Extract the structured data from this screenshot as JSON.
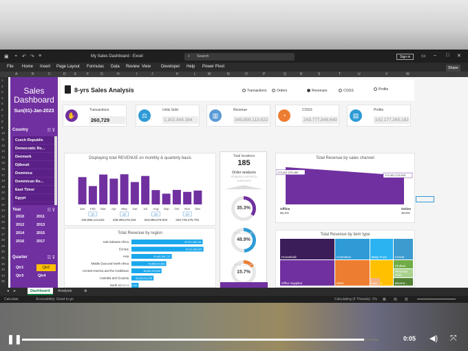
{
  "window": {
    "title": "My Sales Dashboard - Excel",
    "search_placeholder": "Search",
    "signin": "Sign in"
  },
  "menu": [
    "File",
    "Home",
    "Insert",
    "Page Layout",
    "Formulas",
    "Data",
    "Review",
    "View",
    "Developer",
    "Help",
    "Power Pivot"
  ],
  "share_label": "Share",
  "columns": [
    "A",
    "B",
    "C",
    "D",
    "E",
    "F",
    "G",
    "H",
    "I",
    "J",
    "K",
    "L",
    "M",
    "N",
    "O",
    "P",
    "Q",
    "R",
    "S",
    "T",
    "U",
    "V",
    "W"
  ],
  "rows": [
    "1",
    "2",
    "3",
    "4",
    "5",
    "6",
    "7",
    "8",
    "9",
    "10",
    "11",
    "12",
    "13",
    "14",
    "15",
    "16",
    "17",
    "18",
    "19",
    "20",
    "21",
    "22",
    "23",
    "24",
    "25",
    "26",
    "27",
    "28",
    "29",
    "30",
    "31",
    "32",
    "33",
    "34",
    "35"
  ],
  "sidebar": {
    "title": "Sales Dashboard",
    "date": "Sun(01)-Jan-2023",
    "country_label": "Country",
    "countries": [
      "Czech Republic",
      "Democratic Re...",
      "Denmark",
      "Djibouti",
      "Dominica",
      "Dominican Re...",
      "East Timor",
      "Egypt"
    ],
    "year_label": "Year",
    "years": [
      "2010",
      "2011",
      "2012",
      "2013",
      "2014",
      "2015",
      "2016",
      "2017"
    ],
    "quarter_label": "Quarter",
    "quarters": [
      "Qtr1",
      "Qtr2",
      "Qtr3",
      "Qtr4"
    ]
  },
  "header": {
    "title": "8-yrs Sales Analysis",
    "options": [
      "Transactions",
      "Orders",
      "Revenues",
      "COGS",
      "Profits"
    ],
    "selected": "Revenues"
  },
  "kpis": [
    {
      "label": "Transactions",
      "value": "260,729",
      "color": "#7030a0",
      "muted": false
    },
    {
      "label": "Units Sold",
      "value": "1,302,944,384",
      "color": "#2e9bd6",
      "muted": true
    },
    {
      "label": "Revenue",
      "value": "349,899,113,622",
      "color": "#5b9bd5",
      "muted": true
    },
    {
      "label": "COGS",
      "value": "243,777,848,640",
      "color": "#ed7d31",
      "muted": true
    },
    {
      "label": "Profits",
      "value": "102,177,265,182",
      "color": "#2e9bd6",
      "muted": true
    }
  ],
  "center": {
    "total_locations_label": "Total locations",
    "total_locations": "185",
    "order_analysis": "Order analysis",
    "shipping_label": "Shipping interval to customers",
    "donuts": [
      {
        "value": "35.3%",
        "fraction": 0.353,
        "color": "#7030a0"
      },
      {
        "value": "48.9%",
        "fraction": 0.489,
        "color": "#2e9bd6"
      },
      {
        "value": "15.7%",
        "fraction": 0.157,
        "color": "#ed7d31"
      }
    ],
    "within_labels": [
      "within 2 months",
      "within 1 month",
      "within a week"
    ]
  },
  "tree": {
    "title": "Total  Revenue by item type",
    "items": [
      "Household",
      "Cosmetics",
      "Baby Food",
      "Cereal",
      "Office Supplies",
      "Meat",
      "Snacks",
      "Clothes",
      "Personal Care",
      "Fruits",
      "Bevera..."
    ]
  },
  "tabs": [
    "Dashboard",
    "Analysis"
  ],
  "status": {
    "left": "Calculate",
    "access": "Accessibility: Good to go",
    "calc": "Calculating (4 Threads): 1%"
  },
  "player": {
    "time": "0:05",
    "progress": 0.96
  },
  "chart_data": [
    {
      "type": "bar",
      "title": "Displaying total  REVENUE on monthly & quarterly basis",
      "categories": [
        "Jan",
        "Feb",
        "Mar",
        "Apr",
        "May",
        "Jun",
        "Jul",
        "Aug",
        "Sep",
        "Oct",
        "Nov",
        "Dec"
      ],
      "values": [
        30.5,
        20.5,
        33.4,
        28.8,
        33.7,
        25.0,
        31.8,
        16.0,
        12.0,
        16.2,
        14.0,
        15.5
      ],
      "ylim": [
        0,
        40
      ],
      "quarters": [
        "Q1",
        "Q2",
        "Q3",
        "Q4"
      ],
      "quarter_totals": [
        "345,895,113,622",
        "339,085,678,318",
        "323,998,579,004",
        "329,749,275,702"
      ]
    },
    {
      "type": "bar",
      "orientation": "horizontal",
      "title": "Total  Revenue by region",
      "categories": [
        "Sub-Saharan Africa",
        "Europe",
        "Asia",
        "Middle East and North Africa",
        "Central America and the Caribbean",
        "Australia and Oceania",
        "North America"
      ],
      "values": [
        90,
        91,
        51,
        44,
        38,
        28,
        9
      ],
      "labels": [
        "90,971,082,191",
        "91,411,382,827",
        "51,461,361,737",
        "43,888,019,853",
        "38,083,378,638",
        "28,189,413,978",
        "8,806,834,761"
      ],
      "xlim": [
        0,
        100
      ]
    },
    {
      "type": "area",
      "title": "Total  Revenue by sales channel",
      "categories": [
        "Offline",
        "Online"
      ],
      "values": [
        173401979000,
        172401170000
      ],
      "point_labels": [
        "173,401,979,989",
        "172,401,170,633"
      ],
      "shares": [
        "50.2%",
        "49.8%"
      ]
    }
  ]
}
